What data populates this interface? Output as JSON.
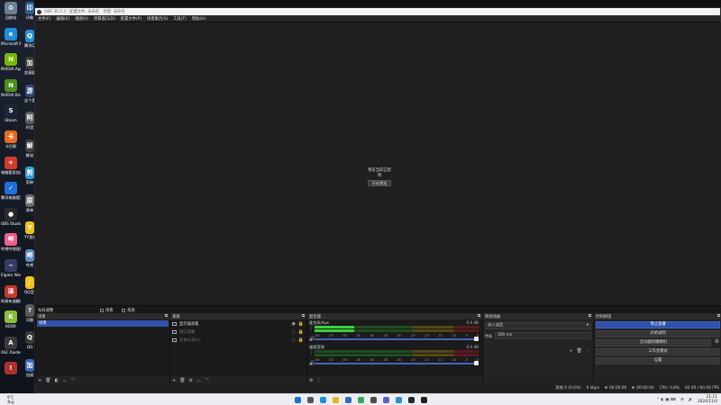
{
  "desktop": {
    "col1": [
      {
        "label": "回收站",
        "color": "#6f7f95",
        "glyph": "♻"
      },
      {
        "label": "Microsoft Edge",
        "color": "#1c8fd6",
        "glyph": "e"
      },
      {
        "label": "NVIDIA App",
        "color": "#76b900",
        "glyph": "N"
      },
      {
        "label": "NVIDIA Broadcast",
        "color": "#4b8f1c",
        "glyph": "N"
      },
      {
        "label": "Steam",
        "color": "#1b2838",
        "glyph": "S"
      },
      {
        "label": "卡巴斯",
        "color": "#e86a1c",
        "glyph": "卡"
      },
      {
        "label": "电脑管家加速",
        "color": "#d23b2a",
        "glyph": "✈"
      },
      {
        "label": "腾讯电脑管家",
        "color": "#1e6fd9",
        "glyph": "✓"
      },
      {
        "label": "OBS Studio",
        "color": "#2b2b2b",
        "glyph": "●"
      },
      {
        "label": "哔哩哔哩直播姬",
        "color": "#f25d8e",
        "glyph": "哔"
      },
      {
        "label": "Elgato Wave Link",
        "color": "#3a3a66",
        "glyph": "~"
      },
      {
        "label": "网易有道翻译",
        "color": "#c0392b",
        "glyph": "译"
      },
      {
        "label": "KOOK",
        "color": "#88c03b",
        "glyph": "K"
      },
      {
        "label": "ASC Raiders",
        "color": "#3a3a3a",
        "glyph": "A"
      },
      {
        "label": "",
        "color": "#b03030",
        "glyph": "!"
      }
    ],
    "col2": [
      {
        "label": "印象",
        "color": "#2c5f8a",
        "glyph": "印"
      },
      {
        "label": "腾讯QQ",
        "color": "#2a8fd6",
        "glyph": "Q"
      },
      {
        "label": "加速器",
        "color": "#3a3a3a",
        "glyph": "加"
      },
      {
        "label": "这个是游戏",
        "color": "#2e4a7a",
        "glyph": "游"
      },
      {
        "label": "阿里",
        "color": "#5a5a5a",
        "glyph": "阿"
      },
      {
        "label": "解说",
        "color": "#3d3d3d",
        "glyph": "解"
      },
      {
        "label": "剪映",
        "color": "#2c9fd8",
        "glyph": "剪"
      },
      {
        "label": "原神",
        "color": "#6a6a6a",
        "glyph": "原"
      },
      {
        "label": "YY直播",
        "color": "#e8c21c",
        "glyph": "Y"
      },
      {
        "label": "哔哩",
        "color": "#5a8ac8",
        "glyph": "哔"
      },
      {
        "label": "QQ音乐",
        "color": "#f0c419",
        "glyph": "♪"
      },
      {
        "label": "问题",
        "color": "#5a5a5a",
        "glyph": "?"
      },
      {
        "label": "QQ",
        "color": "#3a3a3a",
        "glyph": "Q"
      },
      {
        "label": "加速",
        "color": "#3a6ab8",
        "glyph": "加"
      }
    ]
  },
  "window": {
    "title": "OBS 30.2.3 - 配置文件: 未命名 - 场景: 未命名",
    "menu": [
      "文件(F)",
      "编辑(E)",
      "视图(V)",
      "停靠窗口(D)",
      "配置文件(P)",
      "场景集合(S)",
      "工具(T)",
      "帮助(H)"
    ]
  },
  "preview": {
    "message": "预览当前已禁用",
    "button": "开启预览"
  },
  "scene_bar": {
    "left_label": "布局调整",
    "tab1": "场景",
    "tab2": "来源"
  },
  "docks": {
    "scenes": {
      "title": "场景",
      "items": [
        "场景"
      ]
    },
    "sources": {
      "title": "来源",
      "items": [
        {
          "label": "显示器采集",
          "disabled": false
        },
        {
          "label": "窗口采集",
          "disabled": true
        },
        {
          "label": "文本(GDI+)",
          "disabled": true
        }
      ]
    },
    "mixer": {
      "title": "混音器",
      "tracks": [
        {
          "name": "麦克风/Aux",
          "db": "0.0 dB",
          "level": 0.24
        },
        {
          "name": "桌面音频",
          "db": "0.0 dB",
          "level": 0
        }
      ],
      "ticks": [
        "-60",
        "-55",
        "-50",
        "-45",
        "-40",
        "-35",
        "-30",
        "-25",
        "-20",
        "-15",
        "-10",
        "-5",
        "0"
      ]
    },
    "transitions": {
      "title": "转场动画",
      "selected": "淡入淡出",
      "duration_label": "时长",
      "duration": "300 ms"
    },
    "controls": {
      "title": "控制按钮",
      "buttons": [
        {
          "label": "停止直播",
          "active": true
        },
        {
          "label": "开始录制",
          "active": false
        },
        {
          "label": "启动虚拟摄像机",
          "active": false
        },
        {
          "label": "工作室模式",
          "active": false
        },
        {
          "label": "设置",
          "active": false
        }
      ]
    }
  },
  "status": {
    "dropped": "丢帧 0 (0.0%)",
    "bitrate": "0 kbps",
    "stream_time": "00:00:00",
    "rec_time": "00:00:00",
    "cpu": "CPU: 0.8%",
    "fps": "60.00 / 60.00 FPS"
  },
  "taskbar": {
    "weather_temp": "9°C",
    "weather_desc": "多云",
    "time": "21:11",
    "date": "2024/11/4",
    "icons": [
      {
        "name": "start-icon",
        "color": "#1f6fd6"
      },
      {
        "name": "search-icon",
        "color": "#555555"
      },
      {
        "name": "edge-icon",
        "color": "#1c8fd6"
      },
      {
        "name": "explorer-icon",
        "color": "#e6b422"
      },
      {
        "name": "store-icon",
        "color": "#2c6fb8"
      },
      {
        "name": "chrome-icon",
        "color": "#3aa757"
      },
      {
        "name": "app-icon",
        "color": "#4a4a4a"
      },
      {
        "name": "teams-icon",
        "color": "#5b5fc7"
      },
      {
        "name": "qq-icon",
        "color": "#2a8fd6"
      },
      {
        "name": "steam-icon",
        "color": "#1b2838"
      },
      {
        "name": "obs-icon",
        "color": "#222222"
      }
    ]
  }
}
